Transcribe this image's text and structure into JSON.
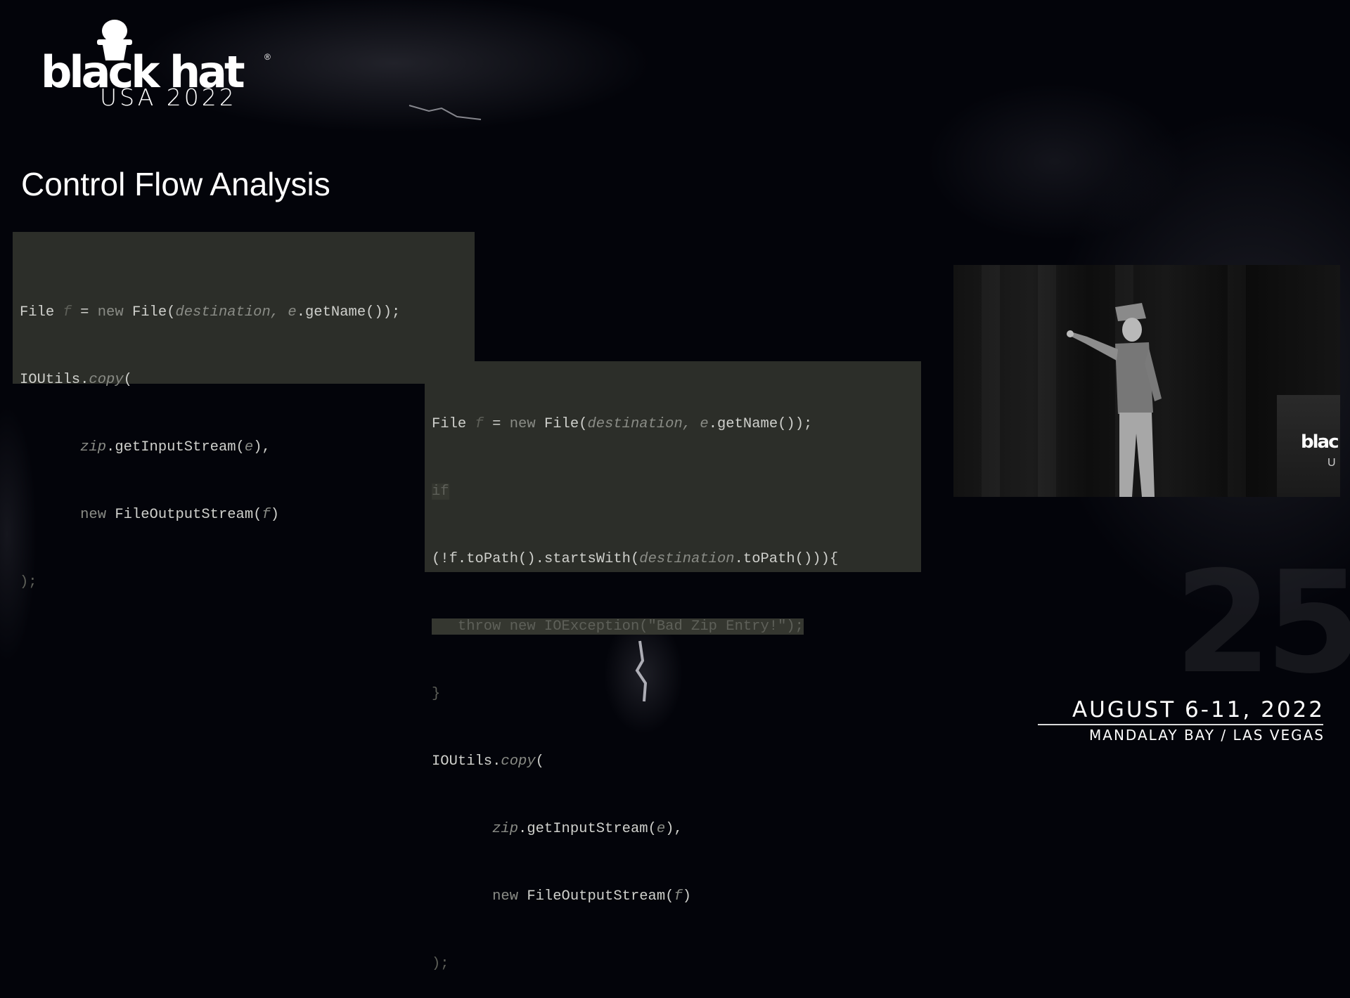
{
  "logo": {
    "wordmark": "black hat",
    "registered": "®",
    "edition": "USA 2022",
    "icon": "hat-figure-icon"
  },
  "slide": {
    "title": "Control Flow Analysis"
  },
  "code_before": {
    "lines": [
      [
        "File ",
        "f",
        " = ",
        "new",
        " File(",
        "destination,",
        " ",
        "e",
        ".getName());"
      ],
      [
        "IOUtils.",
        "copy",
        "("
      ],
      [
        "       ",
        "zip",
        ".getInputStream(",
        "e",
        "),"
      ],
      [
        "       ",
        "new",
        " FileOutputStream(",
        "f",
        ")"
      ],
      [
        ");"
      ]
    ]
  },
  "code_after": {
    "lines": [
      [
        "File ",
        "f",
        " = ",
        "new",
        " File(",
        "destination,",
        " ",
        "e",
        ".getName());"
      ],
      [
        "if"
      ],
      [
        "(!",
        "f",
        ".toPath().startsWith(",
        "destination",
        ".toPath())){"
      ],
      [
        "   throw new IOException(\"Bad Zip Entry!\");"
      ],
      [
        "}"
      ],
      [
        "IOUtils.",
        "copy",
        "("
      ],
      [
        "       ",
        "zip",
        ".getInputStream(",
        "e",
        "),"
      ],
      [
        "       ",
        "new",
        " FileOutputStream(",
        "f",
        ")"
      ],
      [
        ");"
      ]
    ]
  },
  "speaker_video": {
    "banner_word": "blac",
    "banner_sub": "U"
  },
  "background": {
    "anniversary": "25"
  },
  "event": {
    "dates": "AUGUST 6-11, 2022",
    "venue": "MANDALAY BAY / LAS VEGAS"
  }
}
